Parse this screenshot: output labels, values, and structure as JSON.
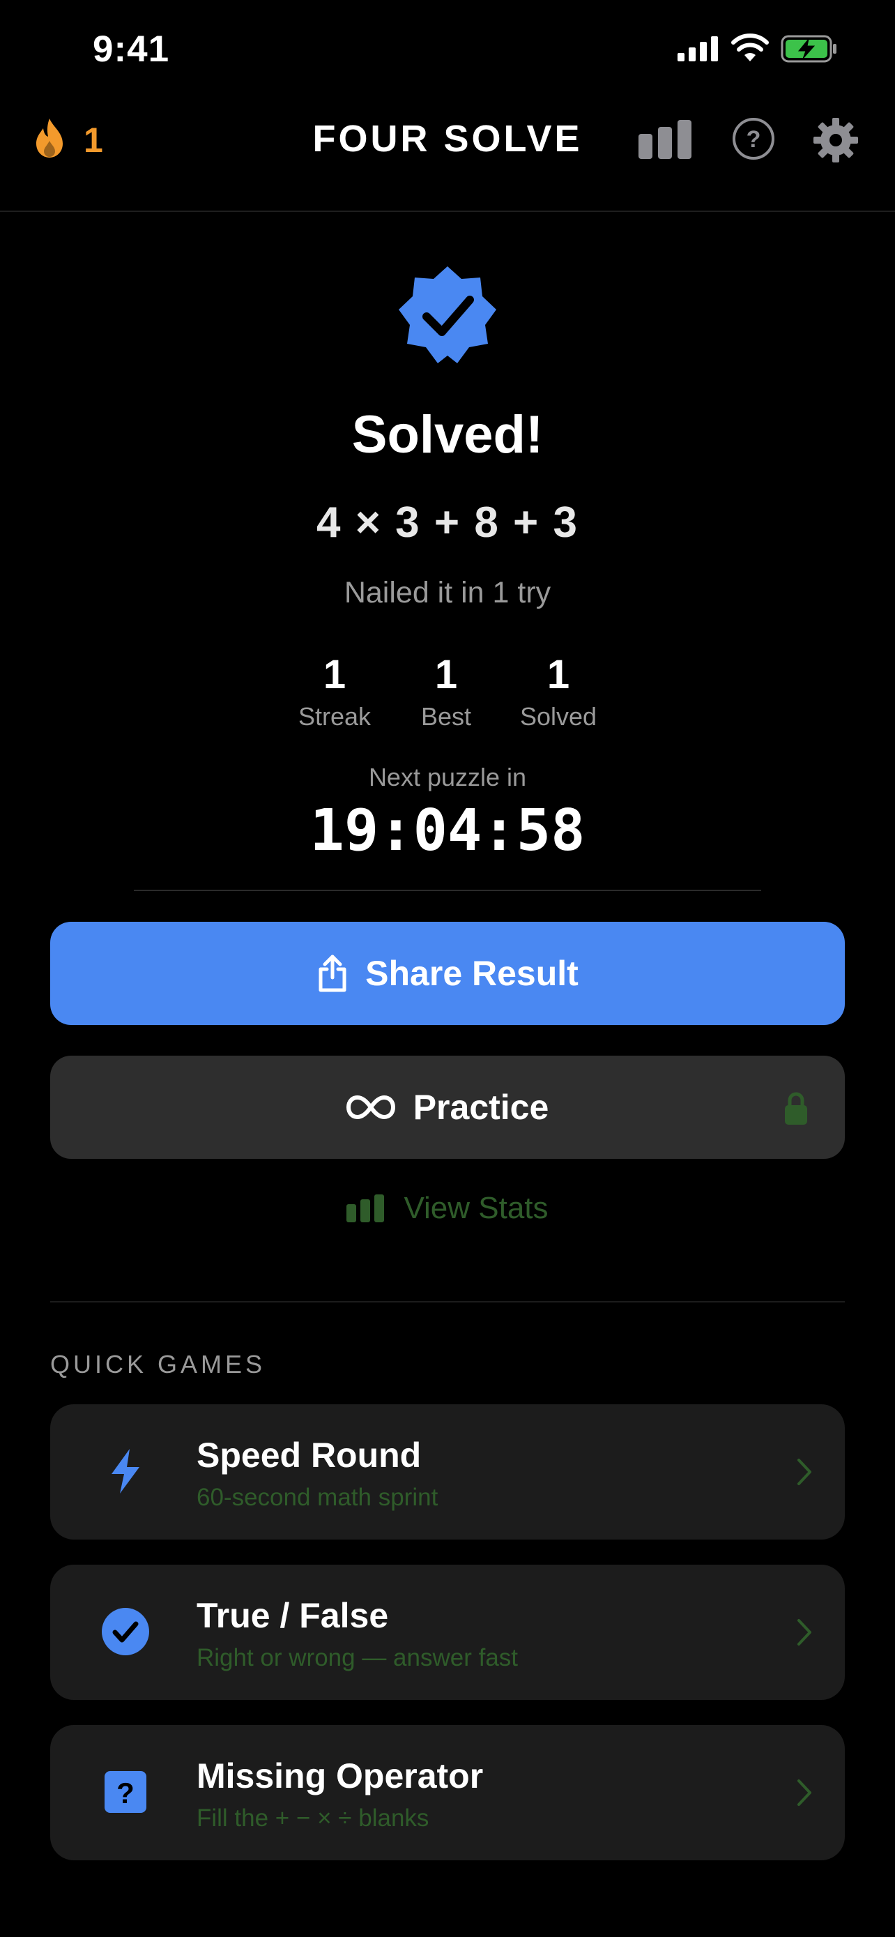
{
  "status_bar": {
    "time": "9:41"
  },
  "header": {
    "streak_count": "1",
    "title": "FOUR SOLVE"
  },
  "result": {
    "title": "Solved!",
    "equation": "4 × 3 + 8 + 3",
    "tries_text": "Nailed it in 1 try",
    "stats": [
      {
        "value": "1",
        "label": "Streak"
      },
      {
        "value": "1",
        "label": "Best"
      },
      {
        "value": "1",
        "label": "Solved"
      }
    ],
    "next_label": "Next puzzle in",
    "countdown": "19:04:58"
  },
  "buttons": {
    "share_label": "Share Result",
    "practice_label": "Practice",
    "view_stats_label": "View Stats"
  },
  "quick_games": {
    "section_title": "QUICK GAMES",
    "items": [
      {
        "title": "Speed Round",
        "subtitle": "60-second math sprint",
        "icon": "lightning-icon"
      },
      {
        "title": "True / False",
        "subtitle": "Right or wrong — answer fast",
        "icon": "check-circle-icon"
      },
      {
        "title": "Missing Operator",
        "subtitle": "Fill the + − × ÷ blanks",
        "icon": "question-square-icon"
      }
    ]
  },
  "colors": {
    "accent_blue": "#4a88f2",
    "streak_orange": "#f39a2c",
    "muted_green": "#2f5c2a",
    "card_bg": "#1c1c1c"
  }
}
